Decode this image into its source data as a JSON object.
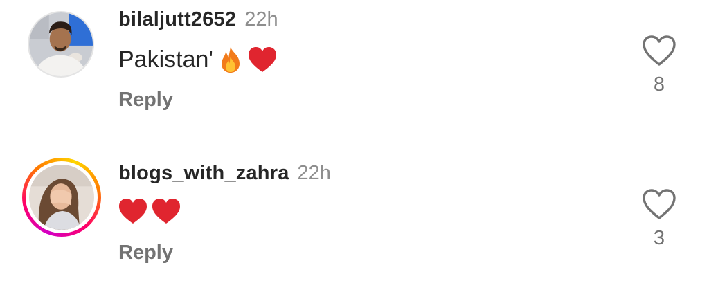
{
  "comments": [
    {
      "username": "bilaljutt2652",
      "time": "22h",
      "text": "Pakistan'",
      "emojis": [
        "fire-emoji",
        "red-heart-emoji"
      ],
      "reply_label": "Reply",
      "like_count": "8",
      "avatar_ring": false
    },
    {
      "username": "blogs_with_zahra",
      "time": "22h",
      "text": "",
      "emojis": [
        "red-heart-emoji",
        "red-heart-emoji"
      ],
      "reply_label": "Reply",
      "like_count": "3",
      "avatar_ring": true
    }
  ],
  "icons": {
    "like": "heart-outline-icon"
  },
  "colors": {
    "text": "#262626",
    "secondary": "#737373",
    "time": "#8e8e8e",
    "heart": "#e0252f"
  }
}
